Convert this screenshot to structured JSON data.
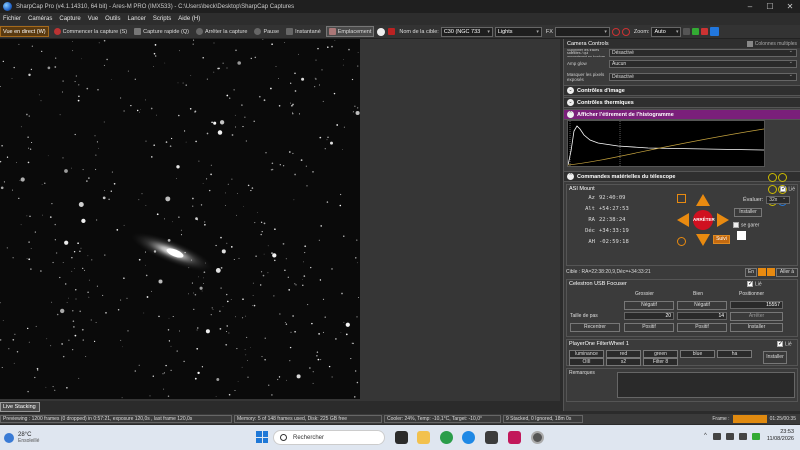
{
  "window": {
    "title": "SharpCap Pro (v4.1.14310, 64 bit) - Ares-M PRO (IMX533) - C:\\Users\\beck\\Desktop\\SharpCap Captures",
    "minimize": "–",
    "maximize": "☐",
    "close": "✕"
  },
  "menu": [
    "Fichier",
    "Caméras",
    "Capture",
    "Vue",
    "Outils",
    "Lancer",
    "Scripts",
    "Aide (H)"
  ],
  "toolbar": {
    "live_view": "Vue en direct (W)",
    "start_capture": "Commencer la capture (S)",
    "quick_capture": "Capture rapide (Q)",
    "stop_capture": "Arrêter la capture",
    "pause": "Pause",
    "snapshot": "Instantané",
    "placement": "Emplacement",
    "target_label": "Nom de la cible:",
    "target_value": "C30 (NGC 733",
    "frame_type": "Lights",
    "fx_label": "FX",
    "zoom_label": "Zoom:",
    "zoom_value": "Auto"
  },
  "live_stacking_tab": "Live Stacking",
  "status": {
    "preview": "Previewing : 1200 frames (0 dropped) in 0:57:21, exposure 120,0s , last frame 120,0s",
    "memory": "Memory: 5 of 148 frames used, Disk: 225 GB free",
    "cooler": "Cooler: 24%, Temp: -10,1°C, Target: -10,0°",
    "stack": "9 Stacked, 0 Ignored, 18m 0s",
    "frame_label": "Frame :",
    "frame_progress": 1.0,
    "time": "01:25/00:35"
  },
  "panel": {
    "title": "Camera Controls",
    "multi_col": "Colonnes multiples",
    "sat_label": "Supprimer les traces satellites / qui apparaissent en bordure de la sortie vidéo",
    "sat_value": "Désactivé",
    "amp_label": "Amp glow",
    "amp_value": "Aucun",
    "mask_label": "Masquer les pixels exposés",
    "mask_value": "Désactivé",
    "sections": {
      "image": "Contrôles d'image",
      "thermal": "Contrôles thermiques",
      "histogram": "Afficher l'étirement de l'histogramme",
      "telescope": "Commandes matérielles du télescope"
    },
    "mount": {
      "title": "ASI Mount",
      "lie": "Lié",
      "coords": [
        {
          "k": "Az",
          "v": "92:40:09"
        },
        {
          "k": "Alt",
          "v": "+54:27:53"
        },
        {
          "k": "RA",
          "v": "22:38:24"
        },
        {
          "k": "Déc",
          "v": "+34:33:19"
        },
        {
          "k": "AH",
          "v": "-02:59:18"
        }
      ],
      "stop": "ARRÊTER",
      "eval_label": "Évaluer:",
      "eval_value": "32x",
      "install": "Installer",
      "park": "se garer",
      "track": "Suivi",
      "target": "Cible : RA=22:38:20,9,Déc=+34:33:21",
      "goto": "Aller à"
    },
    "focuser": {
      "title": "Celestron USB Focuser",
      "lie": "Lié",
      "col_coarse": "Grossier",
      "col_fine": "Bien",
      "col_pos": "Positionner",
      "neg": "Négatif",
      "step_label": "Taille de pas",
      "step_coarse": "20",
      "step_fine": "14",
      "position": "15557",
      "stop": "Arrêter",
      "recenter": "Recentrer",
      "pos": "Positif",
      "install": "Installer"
    },
    "filterwheel": {
      "title": "PlayerOne FilterWheel 1",
      "lie": "Lié",
      "filters": [
        "luminance",
        "red",
        "green",
        "blue",
        "ha",
        "OIII",
        "s2",
        "Filter 8"
      ],
      "install": "Installer"
    },
    "remarks_label": "Remarques"
  },
  "taskbar": {
    "temp": "28°C",
    "weather": "Ensoleillé",
    "search": "Rechercher",
    "time": "23:53",
    "date": "11/08/2026"
  }
}
